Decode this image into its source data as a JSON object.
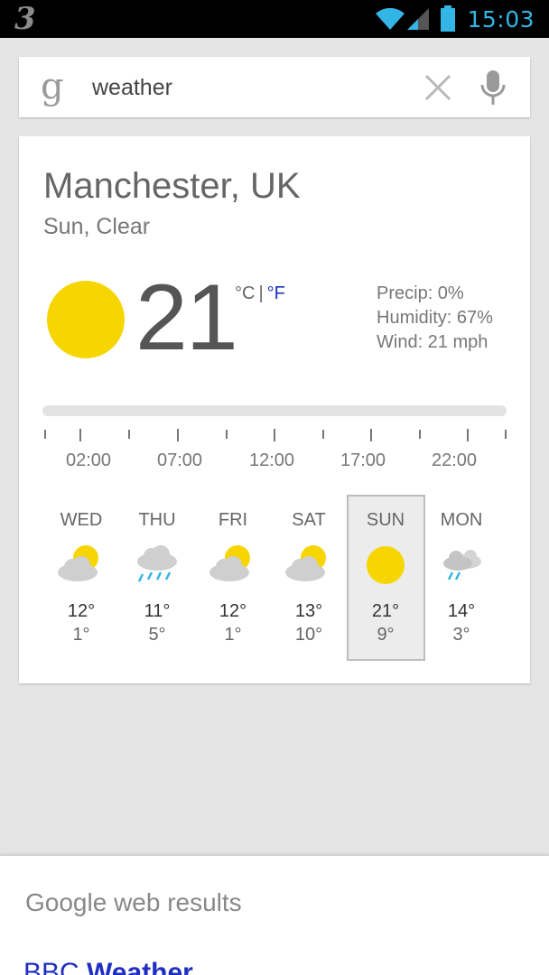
{
  "status_bar": {
    "carrier": "3",
    "time": "15:03",
    "icons": [
      "wifi-icon",
      "signal-icon",
      "battery-icon"
    ]
  },
  "search": {
    "query": "weather",
    "logo": "g",
    "icons": [
      "clear-icon",
      "mic-icon"
    ]
  },
  "weather": {
    "location": "Manchester, UK",
    "condition": "Sun, Clear",
    "temperature": "21",
    "unit_c": "°C",
    "unit_sep": "|",
    "unit_f": "°F",
    "precip": "Precip: 0%",
    "humidity": "Humidity: 67%",
    "wind": "Wind: 21 mph",
    "hours": [
      "02:00",
      "07:00",
      "12:00",
      "17:00",
      "22:00"
    ],
    "forecast": [
      {
        "day": "WED",
        "high": "12°",
        "low": "1°",
        "icon": "partly-cloudy-icon"
      },
      {
        "day": "THU",
        "high": "11°",
        "low": "5°",
        "icon": "rain-icon"
      },
      {
        "day": "FRI",
        "high": "12°",
        "low": "1°",
        "icon": "partly-cloudy-icon"
      },
      {
        "day": "SAT",
        "high": "13°",
        "low": "10°",
        "icon": "partly-cloudy-icon"
      },
      {
        "day": "SUN",
        "high": "21°",
        "low": "9°",
        "icon": "sunny-icon"
      },
      {
        "day": "MON",
        "high": "14°",
        "low": "3°",
        "icon": "showers-icon"
      }
    ],
    "selected_day": "SUN"
  },
  "results": {
    "header": "Google web results",
    "first_link_prefix": "BBC",
    "first_link_bold": "Weather"
  },
  "colors": {
    "accent_blue": "#33b5e5",
    "sun_yellow": "#f7d500",
    "link_blue": "#1f2fbf",
    "background": "#e5e5e5"
  }
}
